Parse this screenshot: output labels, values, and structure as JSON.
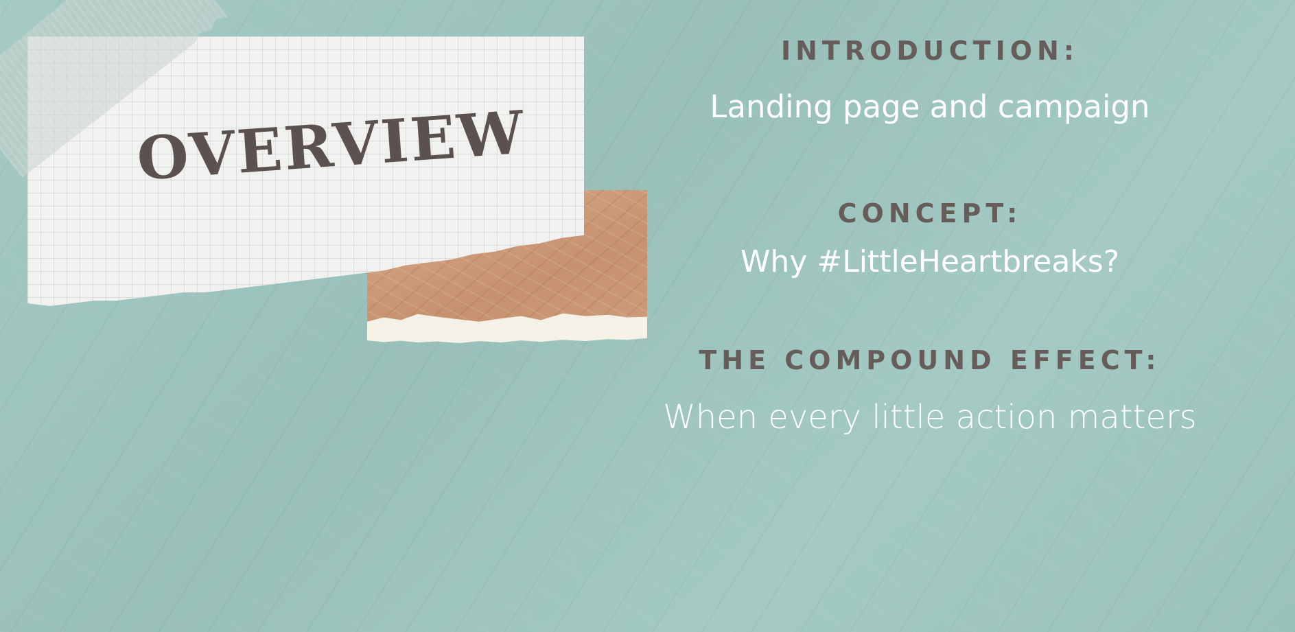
{
  "collage": {
    "title": "OVERVIEW"
  },
  "sections": [
    {
      "heading": "INTRODUCTION:",
      "text": "Landing page and campaign"
    },
    {
      "heading": "CONCEPT:",
      "text": "Why #LittleHeartbreaks?"
    },
    {
      "heading": "THE COMPOUND EFFECT:",
      "text": "When every little action matters"
    }
  ],
  "colors": {
    "background": "#9fc7c0",
    "heading": "#665c59",
    "subtext": "#ffffff",
    "title": "#5b524f",
    "kraft": "#cf9f80",
    "grid_paper": "#f1f1f0"
  }
}
